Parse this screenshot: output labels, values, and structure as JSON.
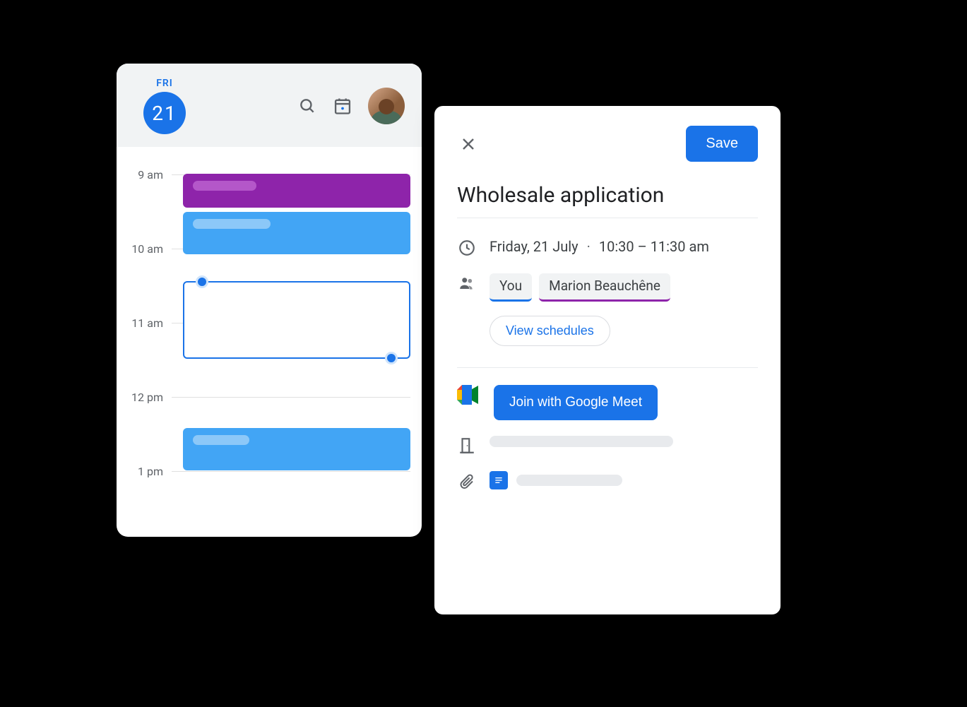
{
  "calendar": {
    "dayOfWeek": "FRI",
    "dayNumber": "21",
    "hours": [
      "9 am",
      "10 am",
      "11 am",
      "12 pm",
      "1 pm"
    ]
  },
  "eventDialog": {
    "saveLabel": "Save",
    "title": "Wholesale application",
    "date": "Friday, 21 July",
    "time": "10:30 – 11:30 am",
    "guests": {
      "you": "You",
      "other": "Marion Beauchêne"
    },
    "viewSchedules": "View schedules",
    "meetButton": "Join with Google Meet"
  }
}
